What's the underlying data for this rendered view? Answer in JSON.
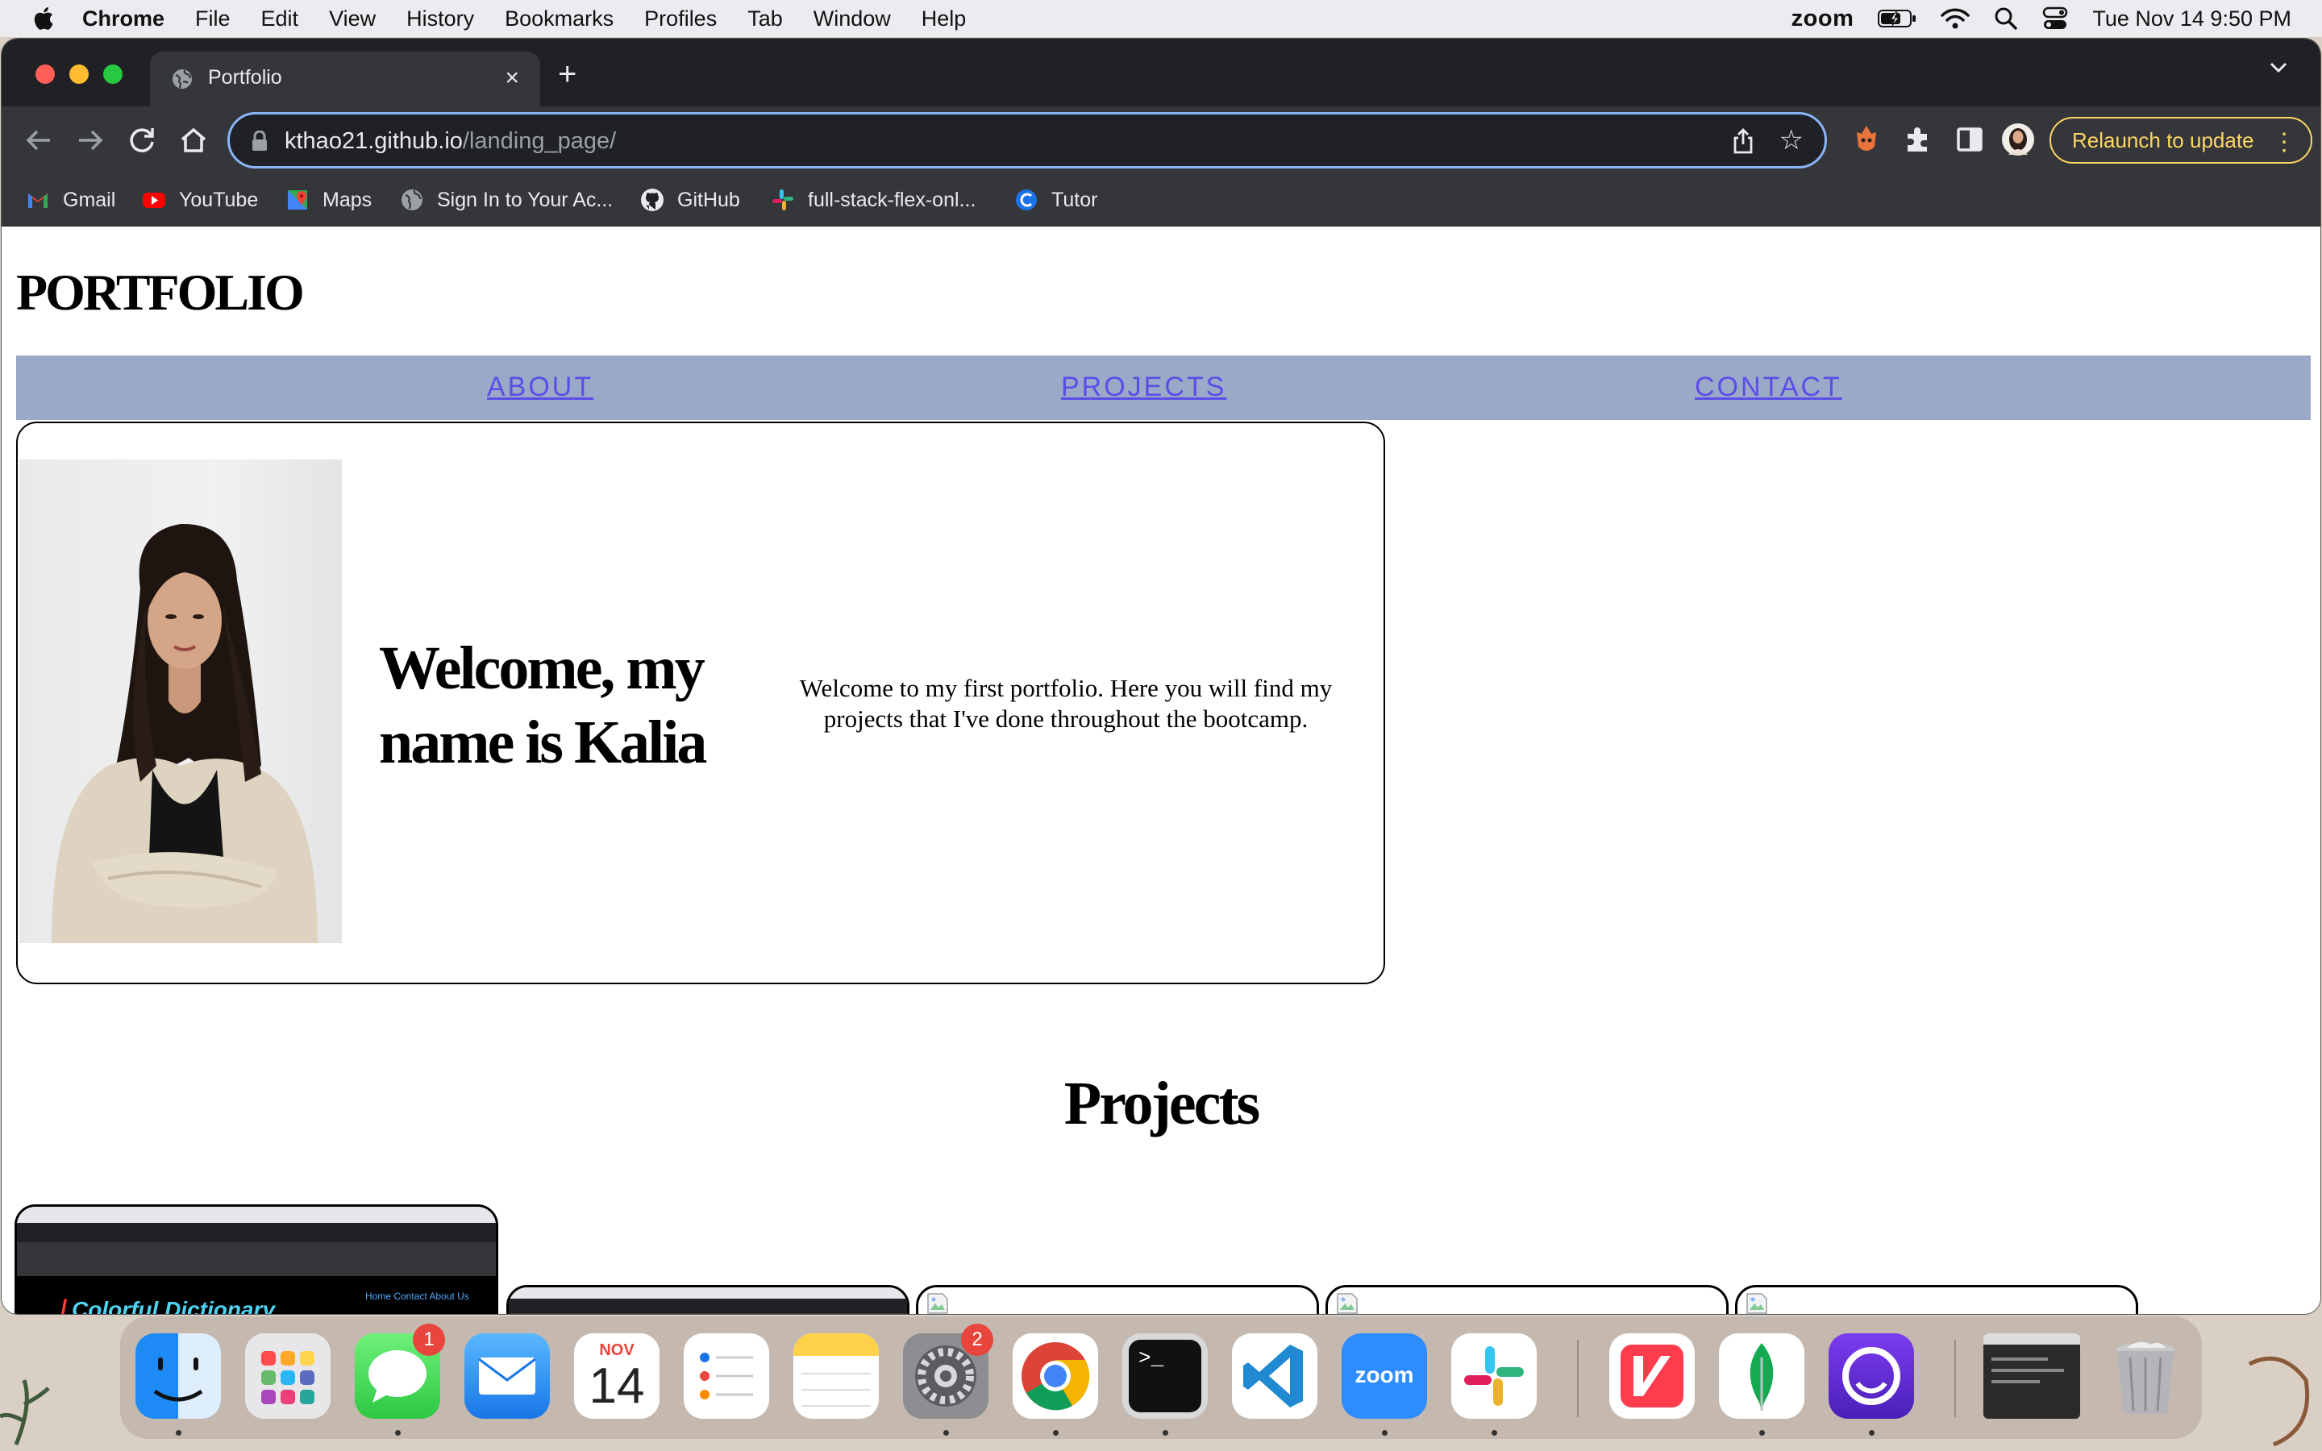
{
  "menubar": {
    "app_name": "Chrome",
    "items": [
      "File",
      "Edit",
      "View",
      "History",
      "Bookmarks",
      "Profiles",
      "Tab",
      "Window",
      "Help"
    ],
    "zoom_label": "zoom",
    "clock": "Tue Nov 14  9:50 PM"
  },
  "browser": {
    "tab_title": "Portfolio",
    "url_host": "kthao21.github.io",
    "url_path": "/landing_page/",
    "relaunch_label": "Relaunch to update",
    "bookmarks": [
      "Gmail",
      "YouTube",
      "Maps",
      "Sign In to Your Ac...",
      "GitHub",
      "full-stack-flex-onl...",
      "Tutor"
    ]
  },
  "page": {
    "logo": "PORTFOLIO",
    "nav": [
      "ABOUT",
      "PROJECTS",
      "CONTACT"
    ],
    "hero_heading": "Welcome, my name is Kalia",
    "hero_text": "Welcome to my first portfolio. Here you will find my projects that I've done throughout the bootcamp.",
    "projects_heading": "Projects",
    "project1_title": "Colorful Dictionary",
    "project1_nav": "Home  Contact  About Us"
  },
  "dock": {
    "apps": [
      "Finder",
      "Launchpad",
      "Messages",
      "Mail",
      "Calendar",
      "Reminders",
      "Notes",
      "System Settings",
      "Chrome",
      "Terminal",
      "Visual Studio Code",
      "Zoom",
      "Slack",
      "News",
      "MongoDB Compass",
      "Screen Recorder",
      "Recent Window",
      "Trash"
    ],
    "calendar_month": "NOV",
    "calendar_day": "14",
    "messages_badge": "1",
    "settings_badge": "2",
    "zoom_label": "zoom"
  },
  "colors": {
    "nav_bg": "#9aa9c8",
    "nav_link": "#5b4ee8",
    "relaunch": "#fdd663",
    "omnibox_focus": "#8ab4f8"
  }
}
